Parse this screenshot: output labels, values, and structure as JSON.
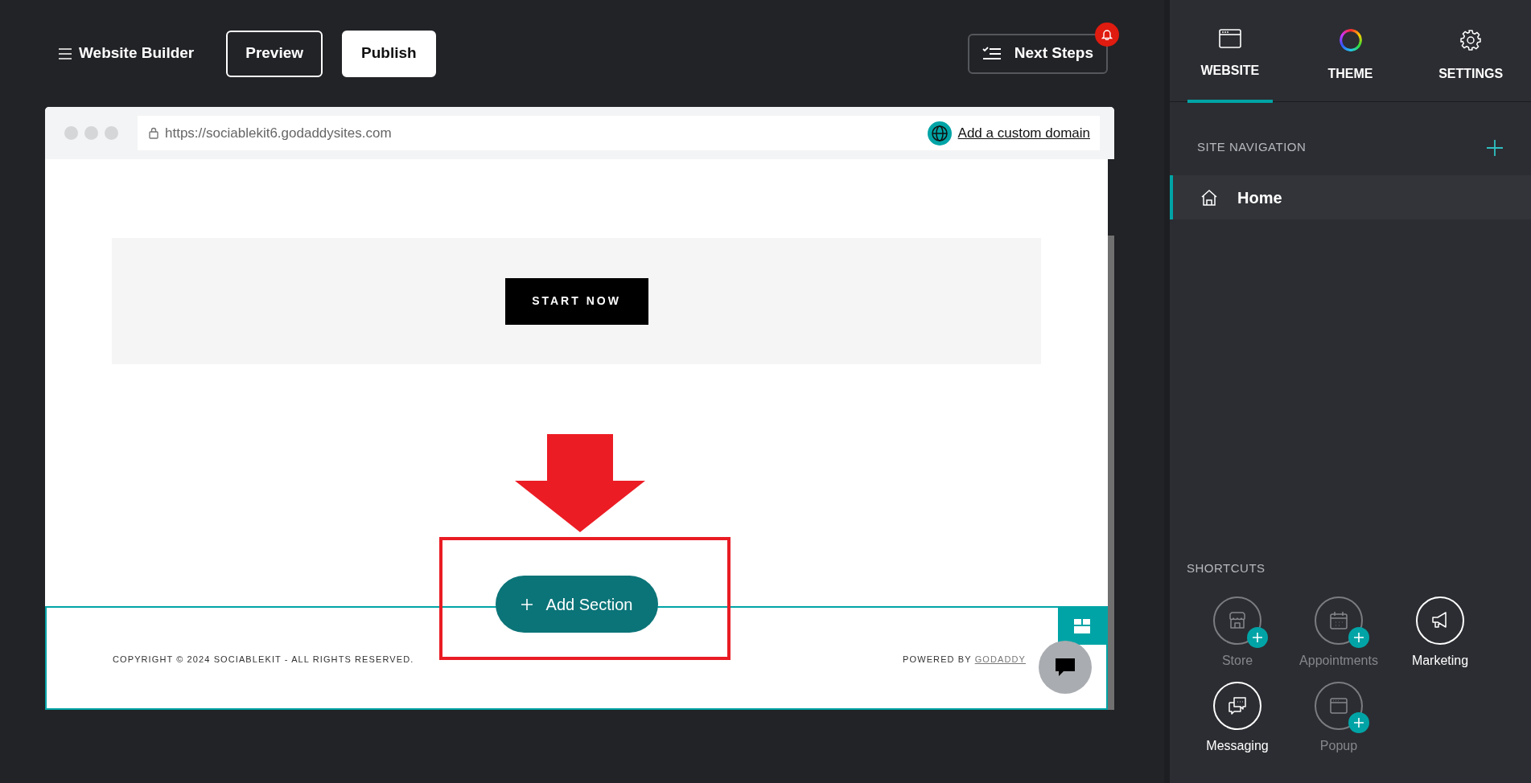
{
  "topbar": {
    "title": "Website Builder",
    "buttons": [
      {
        "label": "Preview",
        "kind": "outline"
      },
      {
        "label": "Publish",
        "kind": "solid"
      }
    ],
    "next_steps": {
      "label": "Next Steps",
      "notification": true
    }
  },
  "browser": {
    "url": "https://sociablekit6.godaddysites.com",
    "domain_link": "Add a custom domain"
  },
  "page": {
    "hero_button": "START NOW",
    "add_section": "Add Section",
    "footer": {
      "copyright": "COPYRIGHT © 2024 SOCIABLEKIT - ALL RIGHTS RESERVED.",
      "powered_by": "POWERED BY",
      "powered_link": "GODADDY"
    }
  },
  "panel": {
    "tabs": [
      {
        "label": "WEBSITE",
        "selected": true
      },
      {
        "label": "THEME",
        "selected": false
      },
      {
        "label": "SETTINGS",
        "selected": false
      }
    ],
    "site_navigation": {
      "heading": "SITE NAVIGATION",
      "items": [
        {
          "label": "Home",
          "selected": true
        }
      ]
    },
    "shortcuts": {
      "heading": "SHORTCUTS",
      "items": [
        {
          "label": "Store",
          "enabled": false
        },
        {
          "label": "Appointments",
          "enabled": false
        },
        {
          "label": "Marketing",
          "enabled": true
        },
        {
          "label": "Messaging",
          "enabled": true
        },
        {
          "label": "Popup",
          "enabled": false
        }
      ]
    }
  }
}
